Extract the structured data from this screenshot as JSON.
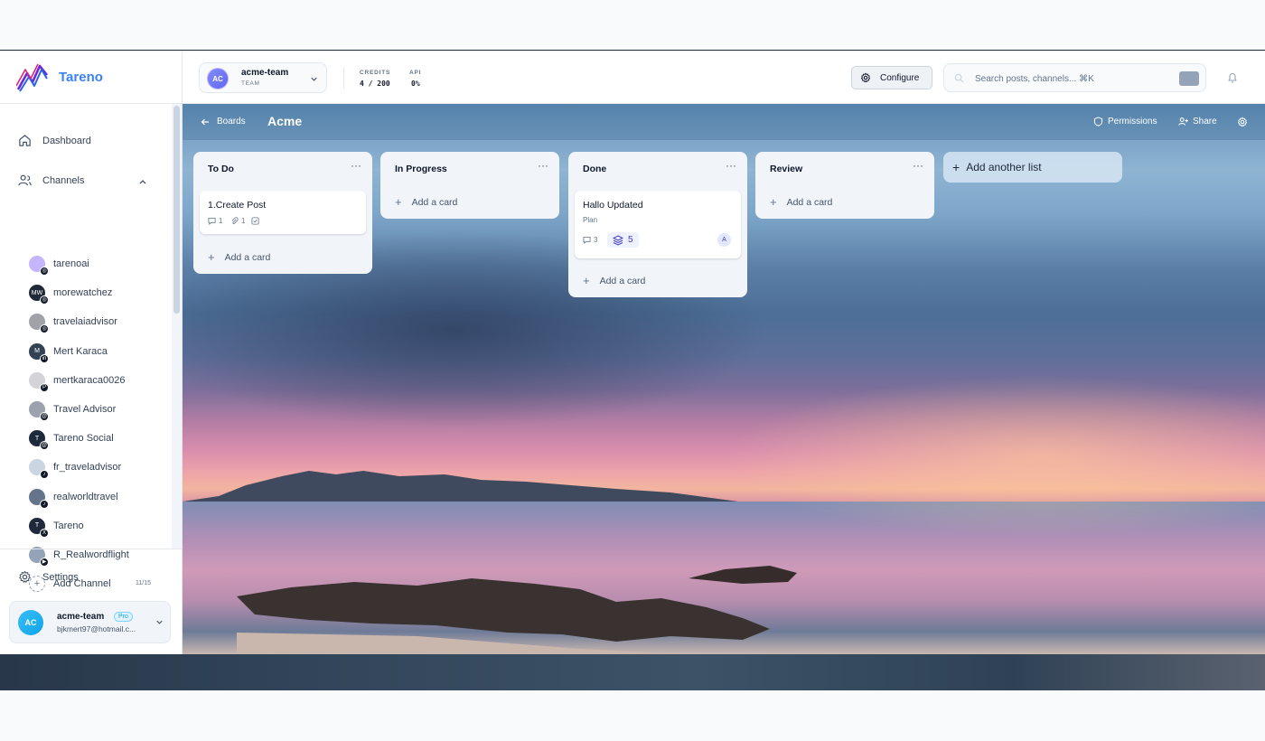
{
  "brand": {
    "name": "Tareno",
    "accent": "#3b82f6"
  },
  "sidebar": {
    "nav": {
      "dashboard": "Dashboard",
      "channels": "Channels",
      "settings": "Settings"
    },
    "channels": [
      {
        "name": "tarenoai",
        "initials": "",
        "network": "instagram"
      },
      {
        "name": "morewatchez",
        "initials": "MW",
        "network": "instagram"
      },
      {
        "name": "travelaiadvisor",
        "initials": "",
        "network": "instagram"
      },
      {
        "name": "Mert Karaca",
        "initials": "M",
        "network": "linkedin"
      },
      {
        "name": "mertkaraca0026",
        "initials": "",
        "network": "pinterest"
      },
      {
        "name": "Travel Advisor",
        "initials": "",
        "network": "threads"
      },
      {
        "name": "Tareno Social",
        "initials": "T",
        "network": "threads"
      },
      {
        "name": "fr_traveladvisor",
        "initials": "",
        "network": "tiktok"
      },
      {
        "name": "realworldtravel",
        "initials": "",
        "network": "tiktok"
      },
      {
        "name": "Tareno",
        "initials": "T",
        "network": "x"
      },
      {
        "name": "R_Realwordflight",
        "initials": "",
        "network": "youtube"
      }
    ],
    "add_channel": "Add Channel",
    "channel_count": "11/15",
    "user": {
      "initials": "AC",
      "name": "acme-team",
      "plan": "Pro",
      "email": "bjkmert97@hotmail.c..."
    }
  },
  "header": {
    "team": {
      "initials": "AC",
      "name": "acme-team",
      "type": "TEAM"
    },
    "credits_label": "CREDITS",
    "credits_value": "4 / 200",
    "api_label": "API",
    "api_value": "0%",
    "configure_label": "Configure",
    "search_placeholder": "Search posts, channels... ⌘K"
  },
  "board": {
    "back_label": "Boards",
    "title": "Acme",
    "permissions_label": "Permissions",
    "share_label": "Share",
    "lists": [
      {
        "title": "To Do",
        "cards": [
          {
            "title": "1.Create Post",
            "comments": "1",
            "attachments": "1"
          }
        ]
      },
      {
        "title": "In Progress",
        "cards": []
      },
      {
        "title": "Done",
        "cards": [
          {
            "title": "Hallo Updated",
            "label": "Plan",
            "comments": "3",
            "layers": "5",
            "assignee": "A"
          }
        ]
      },
      {
        "title": "Review",
        "cards": []
      }
    ],
    "add_card_label": "Add a card",
    "add_list_label": "Add another list",
    "menu_glyph": "···"
  }
}
